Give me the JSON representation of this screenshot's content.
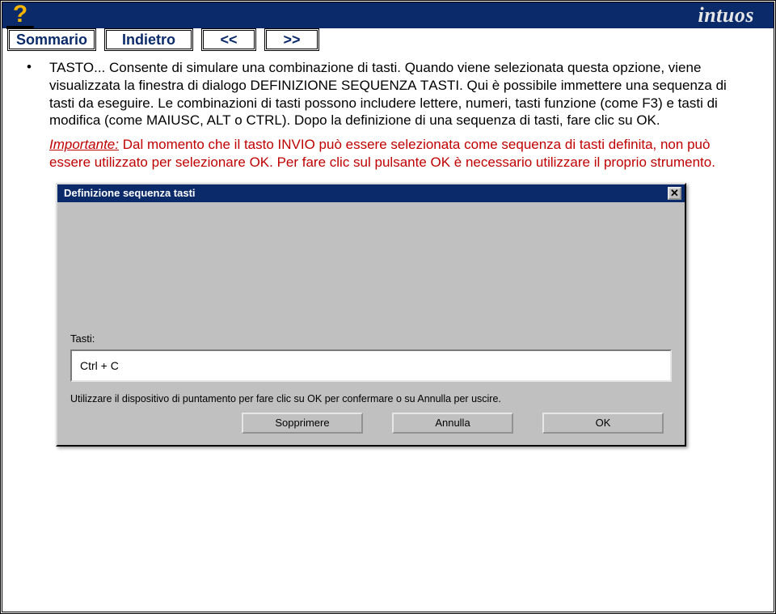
{
  "header": {
    "brand": "intuos",
    "help_tooltip": "?"
  },
  "nav": {
    "summary": "Sommario",
    "back": "Indietro",
    "prev": "<<",
    "next": ">>"
  },
  "doc": {
    "heading_tasto": "TASTO...",
    "para1_a": " Consente di simulare una combinazione di tasti. Quando viene selezionata questa opzione, viene visualizzata la finestra di dialogo D",
    "para1_smallcaps1": "EFINIZIONE",
    "para1_mid1": " S",
    "para1_smallcaps2": "EQUENZA",
    "para1_mid2": " T",
    "para1_smallcaps3": "ASTI",
    "para1_b": ". Qui è possibile immettere una sequenza di tasti da eseguire. Le combinazioni di tasti possono includere lettere, numeri, tasti funzione (come F3) e tasti di modifica (come M",
    "para1_smallcaps4": "AIUSC",
    "para1_c": ", A",
    "para1_smallcaps5": "LT",
    "para1_d": " o C",
    "para1_smallcaps6": "TRL",
    "para1_e": "). Dopo la definizione di una sequenza di tasti, fare clic su OK.",
    "warn_label": "Importante:",
    "warn_a": " Dal momento che il tasto I",
    "warn_sc1": "NVIO",
    "warn_b": " può essere selezionata come sequenza di tasti definita, non può essere utilizzato per selezionare OK. Per fare clic sul pulsante OK è necessario utilizzare il proprio strumento."
  },
  "dialog": {
    "title": "Definizione sequenza tasti",
    "close_glyph": "✕",
    "tasti_label": "Tasti:",
    "tasti_value": "Ctrl + C",
    "hint": "Utilizzare il dispositivo di puntamento per fare clic su OK per confermare o su Annulla per uscire.",
    "buttons": {
      "delete": "Sopprimere",
      "cancel": "Annulla",
      "ok": "OK"
    }
  }
}
